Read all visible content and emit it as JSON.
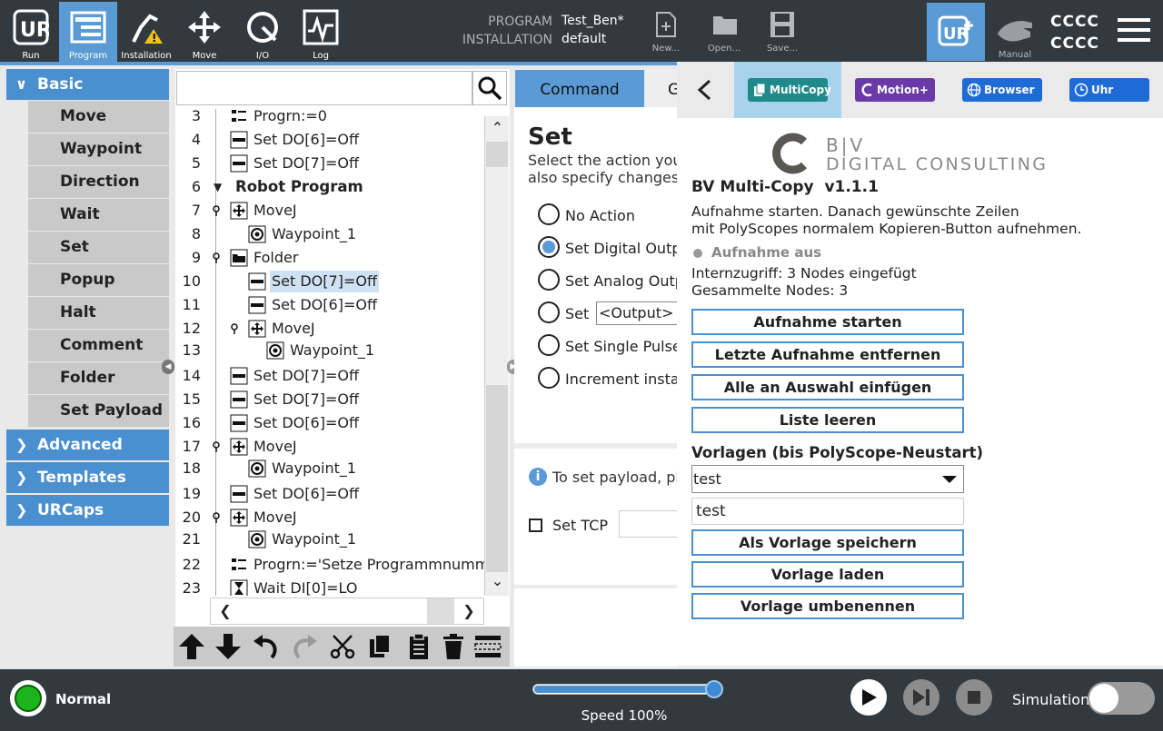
{
  "topbar": {
    "nav": [
      {
        "label": "Run"
      },
      {
        "label": "Program"
      },
      {
        "label": "Installation"
      },
      {
        "label": "Move"
      },
      {
        "label": "I/O"
      },
      {
        "label": "Log"
      }
    ],
    "program_label": "PROGRAM",
    "program_value": "Test_Ben*",
    "installation_label": "INSTALLATION",
    "installation_value": "default",
    "new_label": "New...",
    "open_label": "Open...",
    "save_label": "Save...",
    "manual_label": "Manual",
    "user_line1": "CCCC",
    "user_line2": "CCCC"
  },
  "left": {
    "basic": "Basic",
    "basic_items": [
      "Move",
      "Waypoint",
      "Direction",
      "Wait",
      "Set",
      "Popup",
      "Halt",
      "Comment",
      "Folder",
      "Set Payload"
    ],
    "advanced": "Advanced",
    "templates": "Templates",
    "urcaps": "URCaps"
  },
  "tree": {
    "rows": [
      {
        "num": "3",
        "text": "Progrn:=0"
      },
      {
        "num": "4",
        "text": "Set DO[6]=Off"
      },
      {
        "num": "5",
        "text": "Set DO[7]=Off"
      },
      {
        "num": "6",
        "text": "Robot Program"
      },
      {
        "num": "7",
        "text": "MoveJ"
      },
      {
        "num": "8",
        "text": "Waypoint_1"
      },
      {
        "num": "9",
        "text": "Folder"
      },
      {
        "num": "10",
        "text": "Set DO[7]=Off"
      },
      {
        "num": "11",
        "text": "Set DO[6]=Off"
      },
      {
        "num": "12",
        "text": "MoveJ"
      },
      {
        "num": "13",
        "text": "Waypoint_1"
      },
      {
        "num": "14",
        "text": "Set DO[7]=Off"
      },
      {
        "num": "15",
        "text": "Set DO[7]=Off"
      },
      {
        "num": "16",
        "text": "Set DO[6]=Off"
      },
      {
        "num": "17",
        "text": "MoveJ"
      },
      {
        "num": "18",
        "text": "Waypoint_1"
      },
      {
        "num": "19",
        "text": "Set DO[6]=Off"
      },
      {
        "num": "20",
        "text": "MoveJ"
      },
      {
        "num": "21",
        "text": "Waypoint_1"
      },
      {
        "num": "22",
        "text": "Progrn:='Setze Programmnumm"
      },
      {
        "num": "23",
        "text": "Wait DI[0]=LO"
      }
    ]
  },
  "command": {
    "tab_command": "Command",
    "tab_graphics": "G",
    "title": "Set",
    "desc1": "Select the action you",
    "desc2": "also specify changes",
    "opt_no_action": "No Action",
    "opt_digital": "Set Digital Outpu",
    "opt_analog": "Set Analog Outp",
    "opt_set": "Set",
    "output_select": "<Output>",
    "opt_pulse": "Set Single Pulse",
    "opt_increment": "Increment insta",
    "payload_info": "To set payload, pl",
    "set_tcp": "Set TCP"
  },
  "urcap": {
    "btn_multicopy": "MultiCopy",
    "btn_motion": "Motion+",
    "btn_browser": "Browser",
    "btn_uhr": "Uhr",
    "logo_line1": "B|V",
    "logo_line2": "DIGITAL CONSULTING",
    "title": "BV Multi-Copy  v1.1.1",
    "desc1": "Aufnahme starten. Danach gewünschte Zeilen",
    "desc2": "mit PolyScopes normalem Kopieren-Button aufnehmen.",
    "status": "Aufnahme aus",
    "internal": "Internzugriff: 3 Nodes eingefügt",
    "collected": "Gesammelte Nodes: 3",
    "btn_start": "Aufnahme starten",
    "btn_remove": "Letzte Aufnahme entfernen",
    "btn_insert": "Alle an Auswahl einfügen",
    "btn_clear": "Liste leeren",
    "templates_label": "Vorlagen (bis PolyScope-Neustart)",
    "template_select": "test",
    "template_name": "test",
    "btn_save_tpl": "Als Vorlage speichern",
    "btn_load_tpl": "Vorlage laden",
    "btn_rename_tpl": "Vorlage umbenennen"
  },
  "bottom": {
    "status": "Normal",
    "speed": "Speed 100%",
    "speed_value": 100,
    "simulation": "Simulation"
  }
}
